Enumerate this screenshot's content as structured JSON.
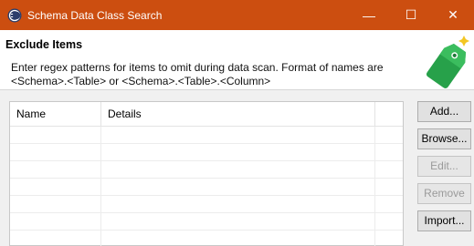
{
  "window": {
    "title": "Schema Data Class Search",
    "app_icon": "eclipse-icon",
    "controls": {
      "minimize": "—",
      "maximize": "☐",
      "close": "✕"
    },
    "accent": "#cc4e10"
  },
  "header": {
    "heading": "Exclude Items",
    "description_line1": "Enter regex patterns for items to omit during data scan. Format of names are",
    "description_line2": "<Schema>.<Table> or <Schema>.<Table>.<Column>",
    "icon": "green-tag-icon"
  },
  "table": {
    "columns": [
      "Name",
      "Details"
    ],
    "rows": []
  },
  "buttons": {
    "add": "Add...",
    "browse": "Browse...",
    "edit": "Edit...",
    "remove": "Remove",
    "import": "Import..."
  }
}
